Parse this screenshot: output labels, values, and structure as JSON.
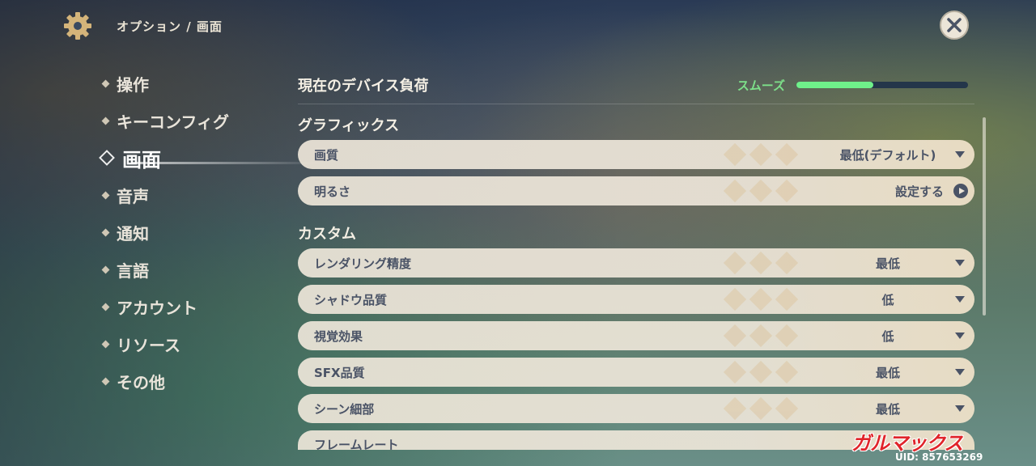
{
  "header": {
    "breadcrumb": "オプション / 画面",
    "icon": "gear-icon",
    "close_icon": "close-icon"
  },
  "sidebar": {
    "items": [
      {
        "label": "操作",
        "active": false
      },
      {
        "label": "キーコンフィグ",
        "active": false
      },
      {
        "label": "画面",
        "active": true
      },
      {
        "label": "音声",
        "active": false
      },
      {
        "label": "通知",
        "active": false
      },
      {
        "label": "言語",
        "active": false
      },
      {
        "label": "アカウント",
        "active": false
      },
      {
        "label": "リソース",
        "active": false
      },
      {
        "label": "その他",
        "active": false
      }
    ]
  },
  "device_load": {
    "title": "現在のデバイス負荷",
    "status": "スムーズ",
    "level_percent": 45,
    "status_color": "#7de08a"
  },
  "graphics": {
    "title": "グラフィックス",
    "rows": [
      {
        "label": "画質",
        "value": "最低(デフォルト)",
        "control": "dropdown"
      },
      {
        "label": "明るさ",
        "value": "設定する",
        "control": "action"
      }
    ]
  },
  "custom": {
    "title": "カスタム",
    "rows": [
      {
        "label": "レンダリング精度",
        "value": "最低"
      },
      {
        "label": "シャドウ品質",
        "value": "低"
      },
      {
        "label": "視覚効果",
        "value": "低"
      },
      {
        "label": "SFX品質",
        "value": "最低"
      },
      {
        "label": "シーン細部",
        "value": "最低"
      },
      {
        "label": "フレームレート",
        "value": ""
      }
    ]
  },
  "watermark": "ガルマックス",
  "uid": "UID: 857653269"
}
